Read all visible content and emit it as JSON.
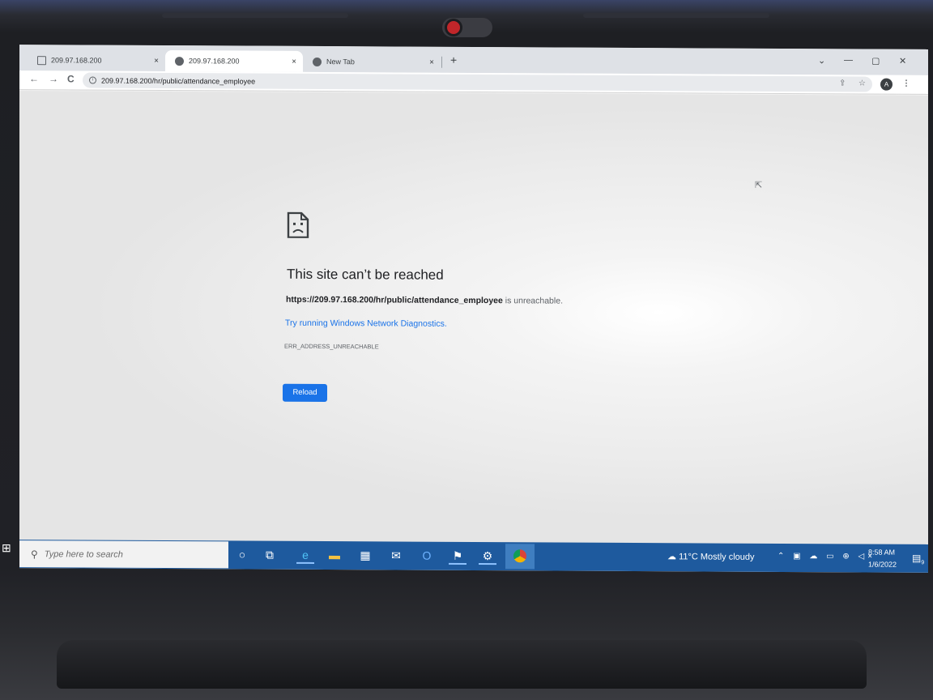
{
  "browser": {
    "tabs": [
      {
        "title": "209.97.168.200",
        "active": false,
        "icon": "page-icon"
      },
      {
        "title": "209.97.168.200",
        "active": true,
        "icon": "globe-icon"
      },
      {
        "title": "New Tab",
        "active": false,
        "icon": "globe-icon"
      }
    ],
    "close_glyph": "×",
    "new_tab_glyph": "+",
    "window_controls": {
      "dropdown": "⌄",
      "minimize": "—",
      "maximize": "▢",
      "close": "✕"
    },
    "nav": {
      "back": "←",
      "forward": "→",
      "reload": "C"
    },
    "address": "209.97.168.200/hr/public/attendance_employee",
    "profile_initial": "A"
  },
  "error_page": {
    "title": "This site can’t be reached",
    "url_bold": "https://209.97.168.200/hr/public/attendance_employee",
    "unreachable_suffix": " is unreachable.",
    "diagnostics_link": "Try running Windows Network Diagnostics.",
    "error_code": "ERR_ADDRESS_UNREACHABLE",
    "reload_label": "Reload"
  },
  "taskbar": {
    "search_placeholder": "Type here to search",
    "weather": "11°C  Mostly cloudy",
    "time": "8:58 AM",
    "date": "1/6/2022",
    "notification_count": "9",
    "accent_color": "#1e5a9e"
  }
}
